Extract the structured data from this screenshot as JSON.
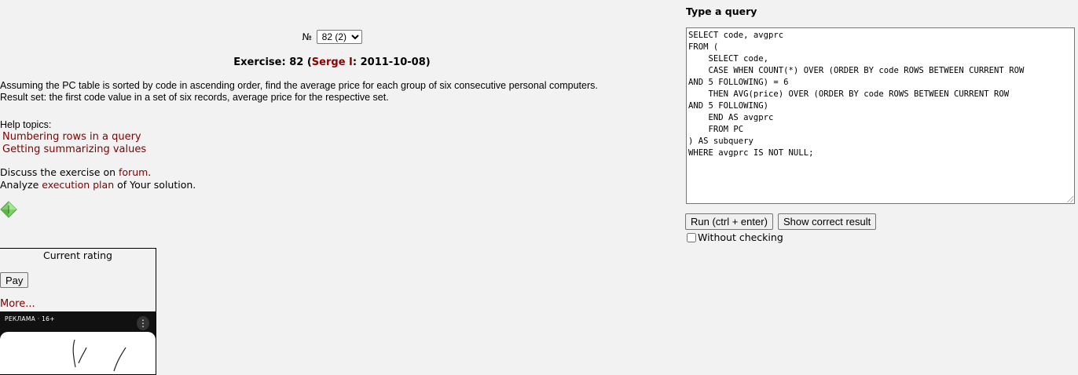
{
  "exercise_selector": {
    "prefix": "№",
    "selected": "82 (2)"
  },
  "exercise": {
    "label": "Exercise: 82",
    "open_paren": "(",
    "author": "Serge I",
    "date": ": 2011-10-08)"
  },
  "description": {
    "line1": "Assuming the PC table is sorted by code in ascending order, find the average price for each group of six consecutive personal computers.",
    "line2": "Result set: the first code value in a set of six records, average price for the respective set."
  },
  "help": {
    "title": "Help topics:",
    "topics": [
      "Numbering rows in a query",
      "Getting summarizing values"
    ]
  },
  "discuss": {
    "prefix": "Discuss the exercise on ",
    "link": "forum",
    "suffix": "."
  },
  "analyze": {
    "prefix": "Analyze ",
    "link": "execution plan",
    "suffix": " of Your solution."
  },
  "rating": {
    "title": "Current rating",
    "pay_label": "Pay",
    "more_label": "More..."
  },
  "ad": {
    "label": "РЕКЛАМА · 16+",
    "menu_icon": "vertical-dots-icon"
  },
  "query": {
    "label": "Type a query",
    "text": "SELECT code, avgprc\nFROM (\n    SELECT code,\n    CASE WHEN COUNT(*) OVER (ORDER BY code ROWS BETWEEN CURRENT ROW\nAND 5 FOLLOWING) = 6\n    THEN AVG(price) OVER (ORDER BY code ROWS BETWEEN CURRENT ROW\nAND 5 FOLLOWING)\n    END AS avgprc\n    FROM PC\n) AS subquery\nWHERE avgprc IS NOT NULL;",
    "run_label": "Run (ctrl + enter)",
    "show_label": "Show correct result",
    "without_checking_label": "Without checking",
    "without_checking_checked": false
  },
  "colors": {
    "background": "#f2f2f2",
    "link": "#800000",
    "author": "#8b0000"
  }
}
